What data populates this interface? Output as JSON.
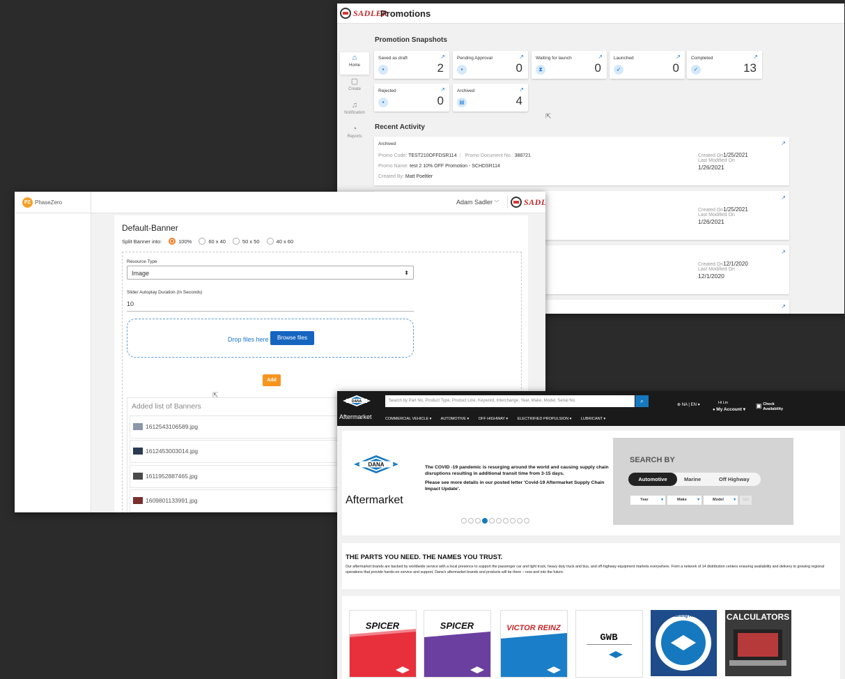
{
  "promotions": {
    "title": "Promotions",
    "logo_text": "SADLER",
    "nav": [
      {
        "label": "Home",
        "icon": "home-icon",
        "glyph": "⌂"
      },
      {
        "label": "Create",
        "icon": "create-doc-icon",
        "glyph": "▢"
      },
      {
        "label": "Notification",
        "icon": "bell-icon",
        "glyph": "♫"
      },
      {
        "label": "Reports",
        "icon": "reports-icon",
        "glyph": "◔"
      }
    ],
    "snapshots_title": "Promotion Snapshots",
    "snapshots": [
      {
        "label": "Saved as draft",
        "count": "2",
        "glyph": "▪"
      },
      {
        "label": "Pending Approval",
        "count": "0",
        "glyph": "▪"
      },
      {
        "label": "Waiting for launch",
        "count": "0",
        "glyph": "⧗"
      },
      {
        "label": "Launched",
        "count": "0",
        "glyph": "➶"
      },
      {
        "label": "Completed",
        "count": "13",
        "glyph": "✓"
      },
      {
        "label": "Rejected",
        "count": "0",
        "glyph": "▪"
      },
      {
        "label": "Archived",
        "count": "4",
        "glyph": "▤"
      }
    ],
    "recent_title": "Recent Activity",
    "activity": {
      "status": "Archived",
      "promo_code_label": "Promo Code:",
      "promo_code": "TEST210OFFDSR114",
      "doc_label": "Promo Document No.:",
      "doc_no": "388721",
      "name_label": "Promo Name:",
      "name": "test 2 10% OFF Promotion - SCHDSR114",
      "created_by_label": "Created By:",
      "created_by": "Matt Poeltler"
    },
    "dates": [
      {
        "created": "1/25/2021",
        "modified": "1/26/2021"
      },
      {
        "created": "1/25/2021",
        "modified": "1/26/2021"
      },
      {
        "created": "12/1/2020",
        "modified": "12/1/2020"
      }
    ],
    "created_on_label": "Created On",
    "last_modified_label": "Last Modified On",
    "arrow": "↗"
  },
  "phasezero": {
    "logo_text": "PhaseZero",
    "logo_badge": "PZ",
    "user": "Adam Sadler",
    "panel_title": "Default-Banner",
    "split_label": "Split Banner into:",
    "split_options": [
      "100%",
      "60 x 40",
      "50 x 50",
      "40 x 60"
    ],
    "resource_type_label": "Resource Type",
    "resource_type_value": "Image",
    "duration_label": "Slider Autoplay Duration (In Seconds)",
    "duration_value": "10",
    "drop_text": "Drop files here",
    "browse_label": "Browse files",
    "add_label": "Add",
    "list_title": "Added list of Banners",
    "banners": [
      "1612543106589.jpg",
      "1612453003014.jpg",
      "1611952887465.jpg",
      "1609801133991.jpg"
    ]
  },
  "dana": {
    "logo_text": "DANA",
    "aftermarket": "Aftermarket",
    "search_placeholder": "Search by Part No, Product Type, Product Line, Keyword, Interchange, Year, Make, Model, Serial No.",
    "nav": [
      "COMMERCIAL VEHICLE ▾",
      "AUTOMOTIVE ▾",
      "OFF HIGHWAY ▾",
      "ELECTRIFIED PROPULSION ▾",
      "LUBRICANT ▾"
    ],
    "region": "NA | EN ▾",
    "hi": "Hi Lin",
    "account": "My Account ▾",
    "check_line1": "Check",
    "check_line2": "Availability",
    "hero_text1": "The COVID -19 pandemic is resurging around the world and causing supply chain disruptions resulting in additional transit time from 3-15 days.",
    "hero_text2": "Please see more details in our posted letter 'Covid-19 Aftermarket Supply Chain Impact Update'.",
    "search_by": "SEARCH BY",
    "tabs": [
      "Automotive",
      "Marine",
      "Off Highway"
    ],
    "dropdowns": [
      "Year",
      "Make",
      "Model"
    ],
    "go_label": "GO",
    "info_title": "THE PARTS YOU NEED. THE NAMES YOU TRUST.",
    "info_body": "Our aftermarket brands are backed by worldwide service with a local presence to support the passenger car and light truck, heavy duty truck and bus, and off-highway equipment markets everywhere.  From a network of 14 distribution centers ensuring availability and delivery to growing regional operations that provide hands-on service and support, Dana's aftermarket brands and products will be there – now and into the future.",
    "brands": [
      "SPICER",
      "SPICER",
      "VICTOR REINZ",
      "GWB",
      "Dana Training Academy",
      "CALCULATORS"
    ],
    "colors": {
      "spicer_red": "#e8303d",
      "spicer_purple": "#6b3fa0",
      "victor_blue": "#1a7fc8",
      "dana_blue": "#1679bf"
    }
  }
}
